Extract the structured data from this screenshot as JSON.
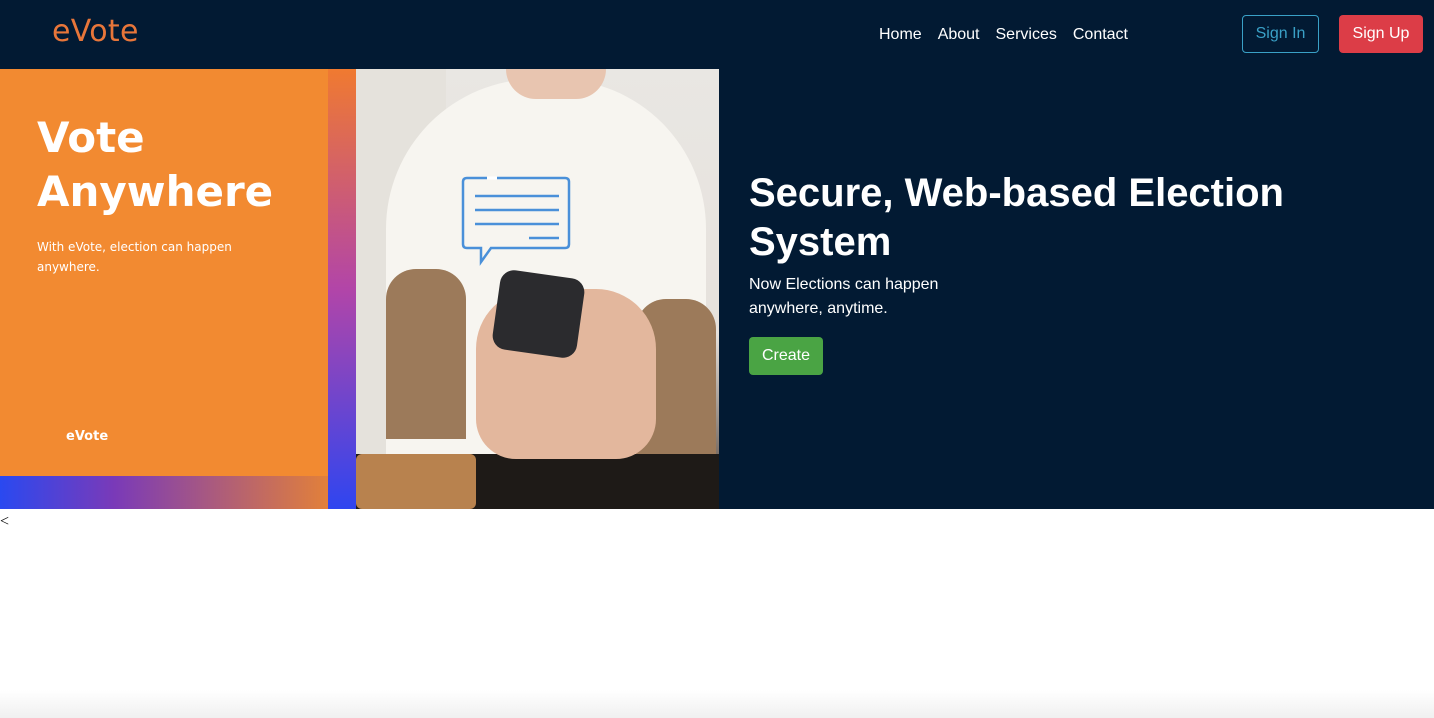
{
  "brand": "eVote",
  "nav": {
    "items": [
      {
        "label": "Home"
      },
      {
        "label": "About"
      },
      {
        "label": "Services"
      },
      {
        "label": "Contact"
      }
    ],
    "sign_in": "Sign In",
    "sign_up": "Sign Up"
  },
  "hero_image": {
    "title": "Vote Anywhere",
    "subtitle": "With eVote,  election  can happen anywhere.",
    "brand": "eVote"
  },
  "hero": {
    "title": "Secure, Web-based Election System",
    "description": "Now Elections can happen anywhere, anytime.",
    "cta": "Create"
  },
  "stray_text": "<",
  "colors": {
    "nav_bg": "#021a33",
    "brand": "#e8763a",
    "sign_in": "#3aa1c7",
    "sign_up": "#dc3d47",
    "create": "#4aa444",
    "orange_panel": "#f28a31"
  }
}
